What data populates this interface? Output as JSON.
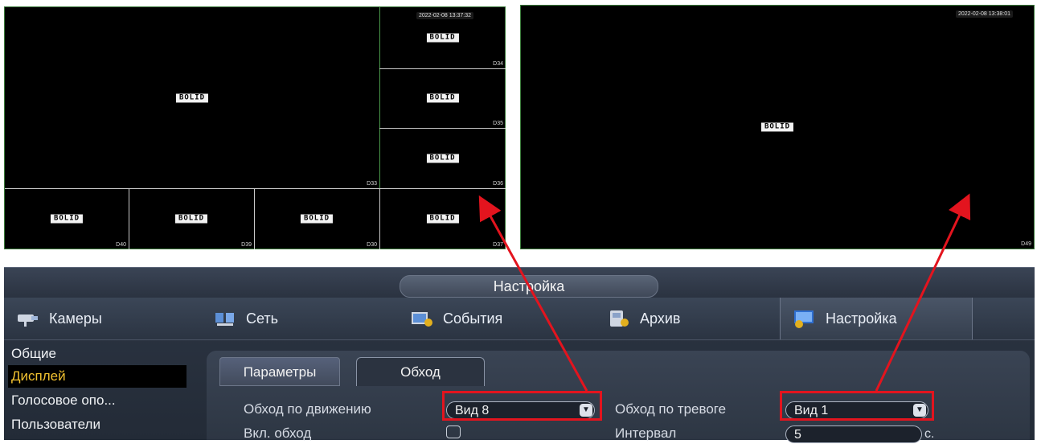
{
  "preview_multi": {
    "timestamp": "2022-02-08 13:37:32",
    "logo": "BOLID",
    "cams": [
      "D33",
      "D34",
      "D35",
      "D36",
      "D37",
      "D30",
      "D39",
      "D40"
    ]
  },
  "preview_single": {
    "timestamp": "2022-02-08 13:38:01",
    "logo": "BOLID",
    "cam": "D49"
  },
  "window": {
    "title": "Настройка"
  },
  "main_tabs": [
    {
      "label": "Камеры",
      "icon": "camera-icon"
    },
    {
      "label": "Сеть",
      "icon": "network-icon"
    },
    {
      "label": "События",
      "icon": "events-icon"
    },
    {
      "label": "Архив",
      "icon": "archive-icon"
    },
    {
      "label": "Настройка",
      "icon": "settings-icon",
      "active": true
    }
  ],
  "sidebar": {
    "items": [
      {
        "label": "Общие"
      },
      {
        "label": "Дисплей",
        "active": true
      },
      {
        "label": "Голосовое опо..."
      },
      {
        "label": "Пользователи"
      }
    ]
  },
  "sub_tabs": [
    {
      "label": "Параметры"
    },
    {
      "label": "Обход",
      "active": true
    }
  ],
  "form": {
    "motion_tour_label": "Обход по движению",
    "motion_tour_value": "Вид 8",
    "alarm_tour_label": "Обход по тревоге",
    "alarm_tour_value": "Вид 1",
    "enable_tour_label": "Вкл. обход",
    "enable_tour_checked": false,
    "interval_label": "Интервал",
    "interval_value": "5",
    "interval_unit": "с."
  },
  "colors": {
    "annotation": "#e3141e",
    "active_sidebar_text": "#f2c230"
  }
}
